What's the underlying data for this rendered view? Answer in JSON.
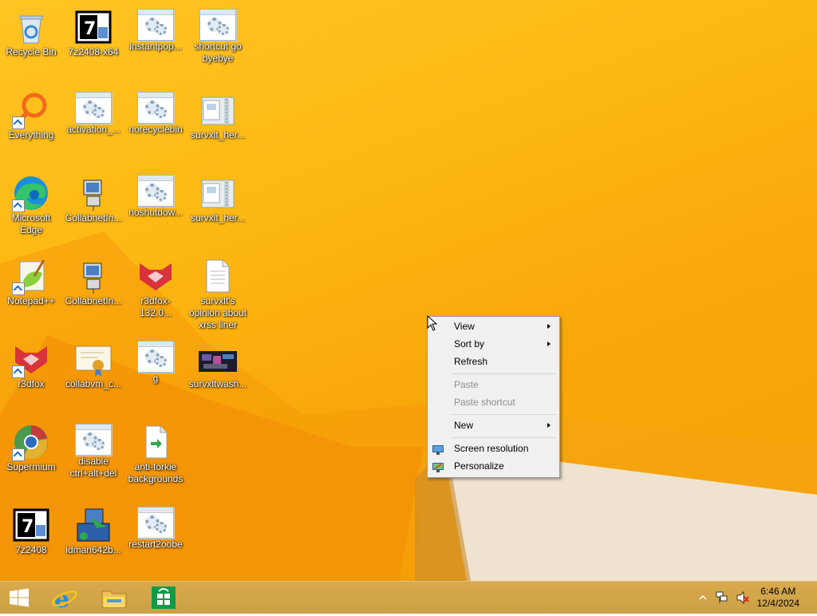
{
  "desktop": {
    "icons": [
      {
        "label": "Recycle Bin",
        "icon": "recycle-bin-icon"
      },
      {
        "label": "7z2408-x64",
        "icon": "7zip-installer-icon"
      },
      {
        "label": "instantpop...",
        "icon": "script-gear-icon"
      },
      {
        "label": "shortcut go byebye",
        "icon": "script-gear-icon"
      },
      {
        "label": "Everything",
        "icon": "everything-search-icon"
      },
      {
        "label": "activation_...",
        "icon": "script-gear-icon"
      },
      {
        "label": "norecyclebin",
        "icon": "script-gear-icon"
      },
      {
        "label": "survxlt_her...",
        "icon": "zip-folder-icon"
      },
      {
        "label": "Microsoft Edge",
        "icon": "edge-icon"
      },
      {
        "label": "CollabnetIn...",
        "icon": "network-computer-icon"
      },
      {
        "label": "noshutdow...",
        "icon": "script-gear-icon"
      },
      {
        "label": "survxlt_her...",
        "icon": "zip-folder-icon"
      },
      {
        "label": "Notepad++",
        "icon": "notepadpp-icon"
      },
      {
        "label": "CollabnetIn...",
        "icon": "network-computer-icon"
      },
      {
        "label": "r3dfox-132.0...",
        "icon": "r3dfox-icon"
      },
      {
        "label": "survxlt's opinion about xrss liner",
        "icon": "text-document-icon"
      },
      {
        "label": "r3dfox",
        "icon": "r3dfox-icon"
      },
      {
        "label": "collabvm_c...",
        "icon": "certificate-icon"
      },
      {
        "label": "g",
        "icon": "script-gear-icon"
      },
      {
        "label": "survxltwash...",
        "icon": "video-thumbnail-icon"
      },
      {
        "label": "Supermium",
        "icon": "supermium-icon"
      },
      {
        "label": "disable ctrl+alt+del",
        "icon": "script-gear-icon"
      },
      {
        "label": "anti-forkie backgrounds",
        "icon": "shortcut-file-icon"
      },
      {
        "label": "7z2408",
        "icon": "7zip-installer-icon"
      },
      {
        "label": "idman642b...",
        "icon": "idm-installer-icon"
      },
      {
        "label": "restart2oobe",
        "icon": "script-gear-icon"
      }
    ]
  },
  "context_menu": {
    "items": [
      {
        "label": "View",
        "submenu": true,
        "enabled": true
      },
      {
        "label": "Sort by",
        "submenu": true,
        "enabled": true
      },
      {
        "label": "Refresh",
        "enabled": true
      },
      {
        "label": "Paste",
        "enabled": false
      },
      {
        "label": "Paste shortcut",
        "enabled": false
      },
      {
        "label": "New",
        "submenu": true,
        "enabled": true
      },
      {
        "label": "Screen resolution",
        "enabled": true,
        "icon": "screen-resolution-icon"
      },
      {
        "label": "Personalize",
        "enabled": true,
        "icon": "personalize-icon"
      }
    ]
  },
  "taskbar": {
    "pinned": [
      "start-icon",
      "internet-explorer-icon",
      "file-explorer-icon",
      "store-icon"
    ],
    "tray": {
      "time": "6:46 AM",
      "date": "12/4/2024"
    }
  },
  "colors": {
    "wallpaper": "#fdb812",
    "taskbar": "#d4a648",
    "menu_bg": "#f0f0f0"
  }
}
